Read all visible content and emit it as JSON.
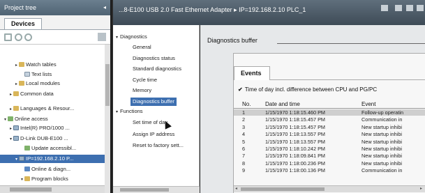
{
  "project_tree": {
    "title": "Project tree",
    "collapse_glyph": "◂",
    "devices_tab": "Devices",
    "items": [
      {
        "label": "Watch tables",
        "expander": "▸",
        "icon": "fold"
      },
      {
        "label": "Text lists",
        "expander": "",
        "icon": "tbl"
      },
      {
        "label": "Local modules",
        "expander": "▸",
        "icon": "fold"
      },
      {
        "label": "Common data",
        "expander": "▸",
        "icon": "fold"
      },
      {
        "label": "Languages & Resour...",
        "expander": "▸",
        "icon": "fold"
      },
      {
        "label": "Online access",
        "expander": "▾",
        "icon": "grn"
      },
      {
        "label": "Intel(R) PRO/1000 ...",
        "expander": "▸",
        "icon": "dev"
      },
      {
        "label": "D-Link DUB-E100 ...",
        "expander": "▾",
        "icon": "dev"
      },
      {
        "label": "Update accessibl...",
        "expander": "",
        "icon": "grn"
      },
      {
        "label": "IP=192.168.2.10 P...",
        "expander": "▾",
        "icon": "dev",
        "selected": true
      },
      {
        "label": "Online & diagn...",
        "expander": "",
        "icon": "blu"
      },
      {
        "label": "Program blocks",
        "expander": "▾",
        "icon": "fold"
      },
      {
        "label": "Add new blo...",
        "expander": "",
        "icon": "blu"
      }
    ]
  },
  "window": {
    "title": "...8-E100 USB 2.0 Fast Ethernet Adapter ▸ IP=192.168.2.10 PLC_1"
  },
  "nav": {
    "diagnostics": "Diagnostics",
    "diagnostics_items": [
      "General",
      "Diagnostics status",
      "Standard diagnostics",
      "Cycle time",
      "Memory",
      "Diagnostics buffer"
    ],
    "functions": "Functions",
    "functions_items": [
      "Set time of day",
      "Assign IP address",
      "Reset to factory sett..."
    ]
  },
  "diagnostics_buffer": {
    "title": "Diagnostics buffer",
    "events_tab": "Events",
    "checkbox_label": "Time of day incl. difference between CPU and PG/PC",
    "columns": {
      "no": "No.",
      "date_time": "Date and time",
      "event": "Event"
    },
    "rows": [
      {
        "no": "1",
        "date_time": "1/15/1970 1:18:15.460 PM",
        "event": "Follow-up operatin",
        "selected": true
      },
      {
        "no": "2",
        "date_time": "1/15/1970 1:18:15.457 PM",
        "event": "Communication in"
      },
      {
        "no": "3",
        "date_time": "1/15/1970 1:18:15.457 PM",
        "event": "New startup inhibi"
      },
      {
        "no": "4",
        "date_time": "1/15/1970 1:18:13.557 PM",
        "event": "New startup inhibi"
      },
      {
        "no": "5",
        "date_time": "1/15/1970 1:18:13.557 PM",
        "event": "New startup inhibi"
      },
      {
        "no": "6",
        "date_time": "1/15/1970 1:18:10.242 PM",
        "event": "New startup inhibi"
      },
      {
        "no": "7",
        "date_time": "1/15/1970 1:18:09.841 PM",
        "event": "New startup inhibi"
      },
      {
        "no": "8",
        "date_time": "1/15/1970 1:18:00.236 PM",
        "event": "New startup inhibi"
      },
      {
        "no": "9",
        "date_time": "1/15/1970 1:18:00.136 PM",
        "event": "Communication in"
      }
    ]
  },
  "colors": {
    "selection": "#3d6fb0",
    "title_bar": "#4f6373",
    "pane_background": "#e6e8ea"
  }
}
